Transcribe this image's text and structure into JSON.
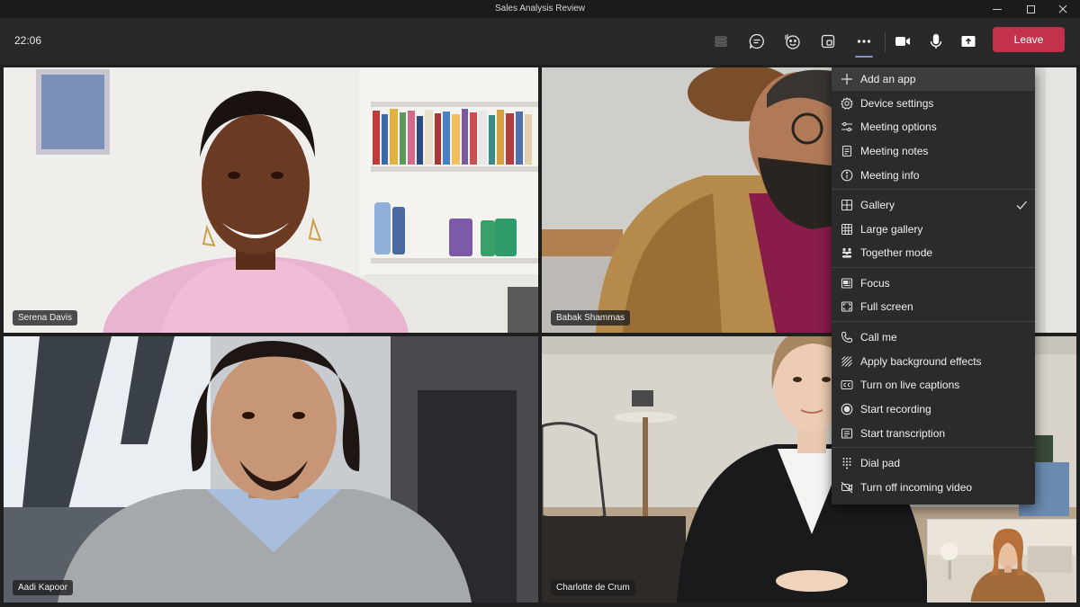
{
  "window": {
    "title": "Sales Analysis Review"
  },
  "toolbar": {
    "clock": "22:06",
    "leave_label": "Leave",
    "icons": [
      "people-icon",
      "chat-icon",
      "reactions-icon",
      "rooms-icon",
      "more-icon",
      "camera-icon",
      "mic-icon",
      "share-icon"
    ]
  },
  "participants": [
    {
      "name": "Serena Davis"
    },
    {
      "name": "Babak Shammas"
    },
    {
      "name": "Aadi Kapoor"
    },
    {
      "name": "Charlotte de Crum"
    }
  ],
  "menu": {
    "groups": [
      [
        {
          "label": "Add an app",
          "icon": "plus-icon"
        },
        {
          "label": "Device settings",
          "icon": "gear-icon"
        },
        {
          "label": "Meeting options",
          "icon": "sliders-icon"
        },
        {
          "label": "Meeting notes",
          "icon": "notes-icon"
        },
        {
          "label": "Meeting info",
          "icon": "info-icon"
        }
      ],
      [
        {
          "label": "Gallery",
          "icon": "gallery-icon",
          "checked": true
        },
        {
          "label": "Large gallery",
          "icon": "large-gallery-icon"
        },
        {
          "label": "Together mode",
          "icon": "together-mode-icon"
        }
      ],
      [
        {
          "label": "Focus",
          "icon": "focus-icon"
        },
        {
          "label": "Full screen",
          "icon": "fullscreen-icon"
        }
      ],
      [
        {
          "label": "Call me",
          "icon": "phone-icon"
        },
        {
          "label": "Apply background effects",
          "icon": "background-effects-icon"
        },
        {
          "label": "Turn on live captions",
          "icon": "captions-icon"
        },
        {
          "label": "Start recording",
          "icon": "record-icon"
        },
        {
          "label": "Start transcription",
          "icon": "transcription-icon"
        }
      ],
      [
        {
          "label": "Dial pad",
          "icon": "dialpad-icon"
        },
        {
          "label": "Turn off incoming video",
          "icon": "video-off-icon"
        }
      ]
    ]
  },
  "colors": {
    "leave": "#c4314b",
    "accent": "#8b8cc7",
    "toolbar": "#292929",
    "menu": "#2b2b2b"
  }
}
